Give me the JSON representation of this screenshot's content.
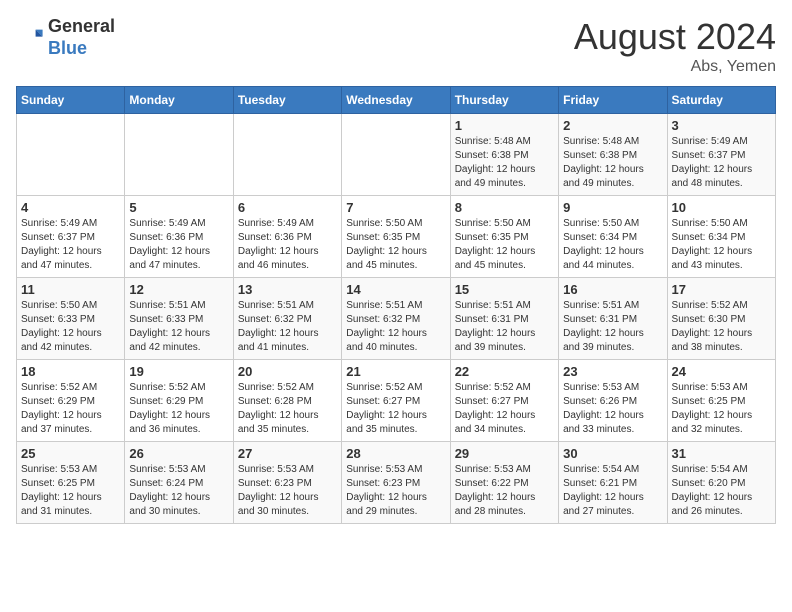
{
  "header": {
    "logo_general": "General",
    "logo_blue": "Blue",
    "month_year": "August 2024",
    "location": "Abs, Yemen"
  },
  "weekdays": [
    "Sunday",
    "Monday",
    "Tuesday",
    "Wednesday",
    "Thursday",
    "Friday",
    "Saturday"
  ],
  "weeks": [
    [
      {
        "day": "",
        "info": ""
      },
      {
        "day": "",
        "info": ""
      },
      {
        "day": "",
        "info": ""
      },
      {
        "day": "",
        "info": ""
      },
      {
        "day": "1",
        "info": "Sunrise: 5:48 AM\nSunset: 6:38 PM\nDaylight: 12 hours\nand 49 minutes."
      },
      {
        "day": "2",
        "info": "Sunrise: 5:48 AM\nSunset: 6:38 PM\nDaylight: 12 hours\nand 49 minutes."
      },
      {
        "day": "3",
        "info": "Sunrise: 5:49 AM\nSunset: 6:37 PM\nDaylight: 12 hours\nand 48 minutes."
      }
    ],
    [
      {
        "day": "4",
        "info": "Sunrise: 5:49 AM\nSunset: 6:37 PM\nDaylight: 12 hours\nand 47 minutes."
      },
      {
        "day": "5",
        "info": "Sunrise: 5:49 AM\nSunset: 6:36 PM\nDaylight: 12 hours\nand 47 minutes."
      },
      {
        "day": "6",
        "info": "Sunrise: 5:49 AM\nSunset: 6:36 PM\nDaylight: 12 hours\nand 46 minutes."
      },
      {
        "day": "7",
        "info": "Sunrise: 5:50 AM\nSunset: 6:35 PM\nDaylight: 12 hours\nand 45 minutes."
      },
      {
        "day": "8",
        "info": "Sunrise: 5:50 AM\nSunset: 6:35 PM\nDaylight: 12 hours\nand 45 minutes."
      },
      {
        "day": "9",
        "info": "Sunrise: 5:50 AM\nSunset: 6:34 PM\nDaylight: 12 hours\nand 44 minutes."
      },
      {
        "day": "10",
        "info": "Sunrise: 5:50 AM\nSunset: 6:34 PM\nDaylight: 12 hours\nand 43 minutes."
      }
    ],
    [
      {
        "day": "11",
        "info": "Sunrise: 5:50 AM\nSunset: 6:33 PM\nDaylight: 12 hours\nand 42 minutes."
      },
      {
        "day": "12",
        "info": "Sunrise: 5:51 AM\nSunset: 6:33 PM\nDaylight: 12 hours\nand 42 minutes."
      },
      {
        "day": "13",
        "info": "Sunrise: 5:51 AM\nSunset: 6:32 PM\nDaylight: 12 hours\nand 41 minutes."
      },
      {
        "day": "14",
        "info": "Sunrise: 5:51 AM\nSunset: 6:32 PM\nDaylight: 12 hours\nand 40 minutes."
      },
      {
        "day": "15",
        "info": "Sunrise: 5:51 AM\nSunset: 6:31 PM\nDaylight: 12 hours\nand 39 minutes."
      },
      {
        "day": "16",
        "info": "Sunrise: 5:51 AM\nSunset: 6:31 PM\nDaylight: 12 hours\nand 39 minutes."
      },
      {
        "day": "17",
        "info": "Sunrise: 5:52 AM\nSunset: 6:30 PM\nDaylight: 12 hours\nand 38 minutes."
      }
    ],
    [
      {
        "day": "18",
        "info": "Sunrise: 5:52 AM\nSunset: 6:29 PM\nDaylight: 12 hours\nand 37 minutes."
      },
      {
        "day": "19",
        "info": "Sunrise: 5:52 AM\nSunset: 6:29 PM\nDaylight: 12 hours\nand 36 minutes."
      },
      {
        "day": "20",
        "info": "Sunrise: 5:52 AM\nSunset: 6:28 PM\nDaylight: 12 hours\nand 35 minutes."
      },
      {
        "day": "21",
        "info": "Sunrise: 5:52 AM\nSunset: 6:27 PM\nDaylight: 12 hours\nand 35 minutes."
      },
      {
        "day": "22",
        "info": "Sunrise: 5:52 AM\nSunset: 6:27 PM\nDaylight: 12 hours\nand 34 minutes."
      },
      {
        "day": "23",
        "info": "Sunrise: 5:53 AM\nSunset: 6:26 PM\nDaylight: 12 hours\nand 33 minutes."
      },
      {
        "day": "24",
        "info": "Sunrise: 5:53 AM\nSunset: 6:25 PM\nDaylight: 12 hours\nand 32 minutes."
      }
    ],
    [
      {
        "day": "25",
        "info": "Sunrise: 5:53 AM\nSunset: 6:25 PM\nDaylight: 12 hours\nand 31 minutes."
      },
      {
        "day": "26",
        "info": "Sunrise: 5:53 AM\nSunset: 6:24 PM\nDaylight: 12 hours\nand 30 minutes."
      },
      {
        "day": "27",
        "info": "Sunrise: 5:53 AM\nSunset: 6:23 PM\nDaylight: 12 hours\nand 30 minutes."
      },
      {
        "day": "28",
        "info": "Sunrise: 5:53 AM\nSunset: 6:23 PM\nDaylight: 12 hours\nand 29 minutes."
      },
      {
        "day": "29",
        "info": "Sunrise: 5:53 AM\nSunset: 6:22 PM\nDaylight: 12 hours\nand 28 minutes."
      },
      {
        "day": "30",
        "info": "Sunrise: 5:54 AM\nSunset: 6:21 PM\nDaylight: 12 hours\nand 27 minutes."
      },
      {
        "day": "31",
        "info": "Sunrise: 5:54 AM\nSunset: 6:20 PM\nDaylight: 12 hours\nand 26 minutes."
      }
    ]
  ]
}
